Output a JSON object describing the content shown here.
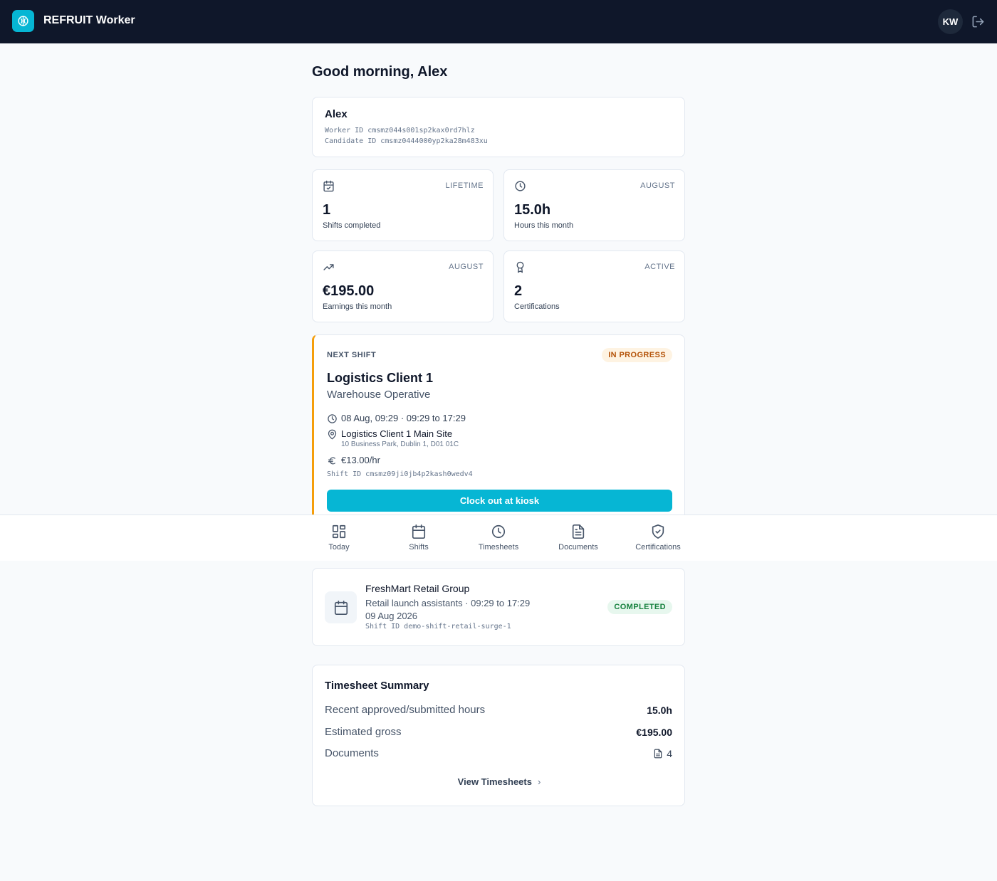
{
  "header": {
    "app_name": "REFRUIT Worker",
    "avatar_initials": "KW"
  },
  "greeting": "Good morning, Alex",
  "profile": {
    "name": "Alex",
    "worker_id": "Worker ID cmsmz044s001sp2kax0rd7hlz",
    "candidate_id": "Candidate ID cmsmz0444000yp2ka28m483xu"
  },
  "stats": [
    {
      "icon": "calendar-check-icon",
      "period": "LIFETIME",
      "value": "1",
      "label": "Shifts completed"
    },
    {
      "icon": "clock-icon",
      "period": "AUGUST",
      "value": "15.0h",
      "label": "Hours this month"
    },
    {
      "icon": "trending-up-icon",
      "period": "AUGUST",
      "value": "€195.00",
      "label": "Earnings this month"
    },
    {
      "icon": "award-icon",
      "period": "ACTIVE",
      "value": "2",
      "label": "Certifications"
    }
  ],
  "next_shift": {
    "eyebrow": "NEXT SHIFT",
    "status": "IN PROGRESS",
    "client": "Logistics Client 1",
    "role": "Warehouse Operative",
    "time": "08 Aug, 09:29 · 09:29 to 17:29",
    "site": "Logistics Client 1 Main Site",
    "address": "10 Business Park, Dublin 1, D01 01C",
    "rate": "€13.00/hr",
    "shift_id": "Shift ID cmsmz09ji0jb4p2kash0wedv4",
    "action": "Clock out at kiosk"
  },
  "nav": [
    {
      "label": "Today",
      "icon": "grid-icon"
    },
    {
      "label": "Shifts",
      "icon": "calendar-icon"
    },
    {
      "label": "Timesheets",
      "icon": "clock-icon"
    },
    {
      "label": "Documents",
      "icon": "document-icon"
    },
    {
      "label": "Certifications",
      "icon": "shield-check-icon"
    }
  ],
  "past_shift": {
    "client": "FreshMart Retail Group",
    "line": "Retail launch assistants · 09:29 to 17:29",
    "date": "09 Aug 2026",
    "shift_id": "Shift ID demo-shift-retail-surge-1",
    "status": "COMPLETED"
  },
  "timesheet_summary": {
    "title": "Timesheet Summary",
    "rows": [
      {
        "label": "Recent approved/submitted hours",
        "value": "15.0h"
      },
      {
        "label": "Estimated gross",
        "value": "€195.00"
      },
      {
        "label": "Documents",
        "value": "4"
      }
    ],
    "link": "View Timesheets"
  },
  "colors": {
    "topbar": "#0f172a",
    "accent": "#06b6d4",
    "in_progress_border": "#f59e0b",
    "completed": "#15803d"
  }
}
